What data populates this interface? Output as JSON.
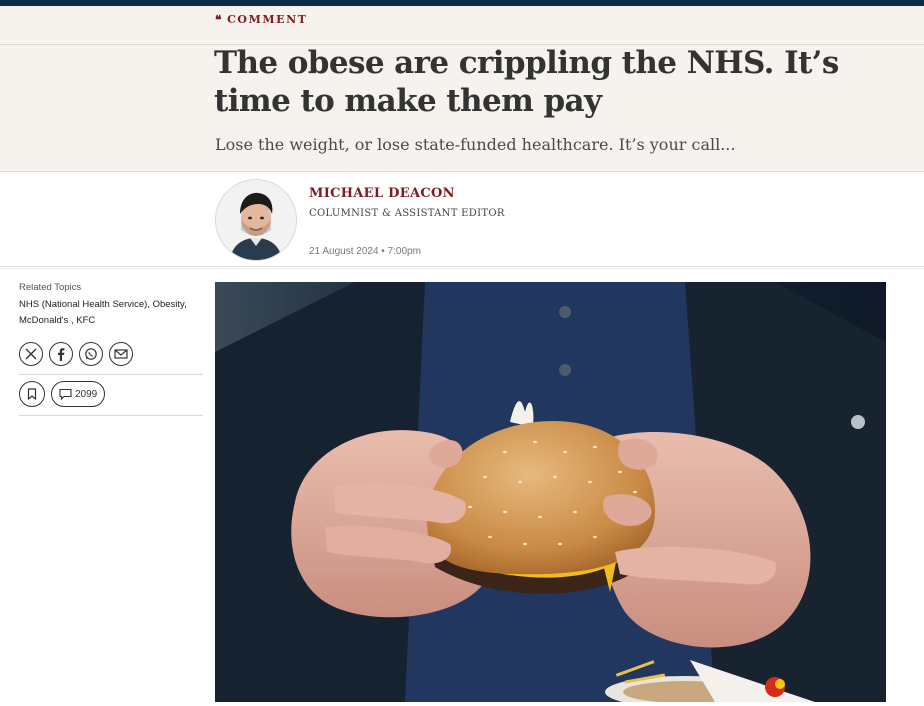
{
  "header": {
    "section_label": "COMMENT",
    "section_icon": "quote-icon",
    "headline": "The obese are crippling the NHS. It’s time to make them pay",
    "standfirst": "Lose the weight, or lose state-funded healthcare. It’s your call..."
  },
  "byline": {
    "author_name": "MICHAEL DEACON",
    "author_role": "COLUMNIST & ASSISTANT EDITOR",
    "published": "21 August 2024 • 7:00pm"
  },
  "sidebar": {
    "related_title": "Related Topics",
    "topics": [
      "NHS (National Health Service)",
      "Obesity",
      "McDonald's",
      "KFC"
    ],
    "share_icons": [
      "x-icon",
      "facebook-icon",
      "whatsapp-icon",
      "email-icon"
    ],
    "comment_count": "2099"
  },
  "colors": {
    "accent": "#7b1b22",
    "header_band": "#f6f2ee",
    "top_bar": "#0e2a3f"
  }
}
